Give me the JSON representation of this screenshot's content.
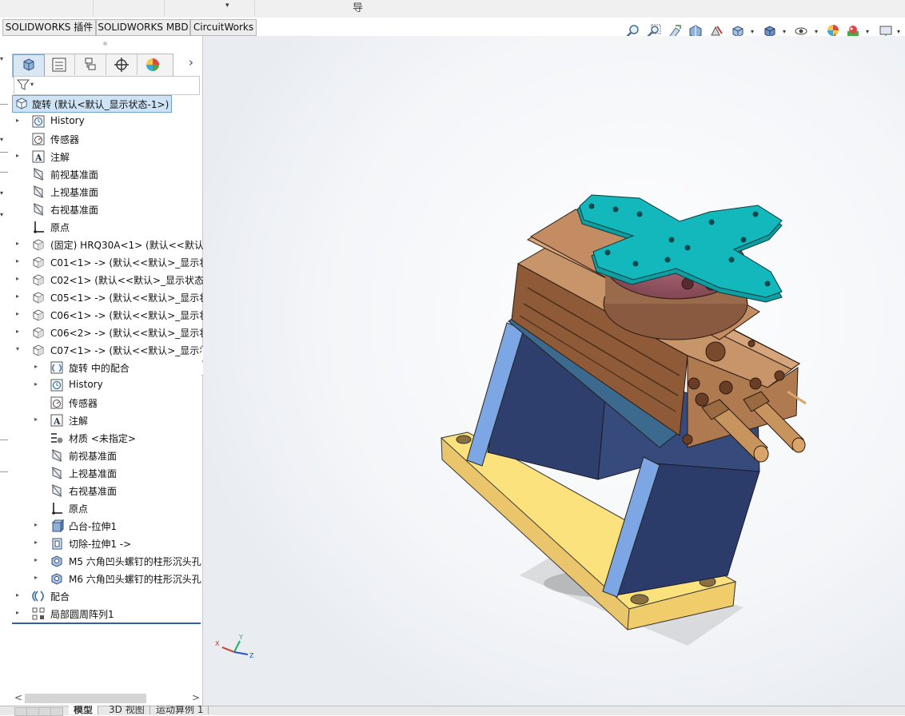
{
  "top_strip": {
    "dropdown_arrow": "▾",
    "glyph": "导"
  },
  "command_tabs": [
    "SOLIDWORKS 插件",
    "SOLIDWORKS MBD",
    "CircuitWorks"
  ],
  "view_toolbar": {
    "icons": [
      "zoom-to-fit-icon",
      "zoom-to-area-icon",
      "previous-view-icon",
      "section-view-icon",
      "dynamic-annotation-view-icon",
      "view-orientation-icon",
      "display-style-icon",
      "hide-show-items-icon",
      "edit-appearance-icon",
      "apply-scene-icon",
      "view-settings-icon"
    ]
  },
  "panel": {
    "tab_icons": [
      "featuremanager-tree-icon",
      "propertymanager-icon",
      "configurationmanager-icon",
      "dimxpertmanager-icon",
      "displaymanager-icon"
    ],
    "more_arrow": "›",
    "filter_dropdown": "▾"
  },
  "tree": {
    "root": {
      "label": "旋转  (默认<默认_显示状态-1>)",
      "icon": "assembly-icon"
    },
    "items": [
      {
        "label": "History",
        "icon": "history-icon",
        "level": 1,
        "toggle": "▸"
      },
      {
        "label": "传感器",
        "icon": "sensor-icon",
        "level": 1,
        "toggle": ""
      },
      {
        "label": "注解",
        "icon": "annotation-icon",
        "level": 1,
        "toggle": "▸"
      },
      {
        "label": "前视基准面",
        "icon": "plane-icon",
        "level": 1,
        "toggle": ""
      },
      {
        "label": "上视基准面",
        "icon": "plane-icon",
        "level": 1,
        "toggle": ""
      },
      {
        "label": "右视基准面",
        "icon": "plane-icon",
        "level": 1,
        "toggle": ""
      },
      {
        "label": "原点",
        "icon": "origin-icon",
        "level": 1,
        "toggle": ""
      },
      {
        "label": "(固定) HRQ30A<1> (默认<<默认>",
        "icon": "subassembly-icon",
        "level": 1,
        "toggle": "▸"
      },
      {
        "label": "C01<1> -> (默认<<默认>_显示状",
        "icon": "part-icon",
        "level": 1,
        "toggle": "▸"
      },
      {
        "label": "C02<1> (默认<<默认>_显示状态",
        "icon": "part-icon",
        "level": 1,
        "toggle": "▸"
      },
      {
        "label": "C05<1> -> (默认<<默认>_显示状",
        "icon": "part-icon",
        "level": 1,
        "toggle": "▸"
      },
      {
        "label": "C06<1> -> (默认<<默认>_显示状",
        "icon": "part-icon",
        "level": 1,
        "toggle": "▸"
      },
      {
        "label": "C06<2> -> (默认<<默认>_显示状",
        "icon": "part-icon",
        "level": 1,
        "toggle": "▸"
      },
      {
        "label": "C07<1> -> (默认<<默认>_显示状",
        "icon": "part-icon",
        "level": 1,
        "toggle": "▾"
      },
      {
        "label": "旋转 中的配合",
        "icon": "mates-in-assembly-icon",
        "level": 2,
        "toggle": "▸"
      },
      {
        "label": "History",
        "icon": "history-icon",
        "level": 2,
        "toggle": "▸"
      },
      {
        "label": "传感器",
        "icon": "sensor-icon",
        "level": 2,
        "toggle": ""
      },
      {
        "label": "注解",
        "icon": "annotation-icon",
        "level": 2,
        "toggle": "▸"
      },
      {
        "label": "材质 <未指定>",
        "icon": "material-icon",
        "level": 2,
        "toggle": ""
      },
      {
        "label": "前视基准面",
        "icon": "plane-icon",
        "level": 2,
        "toggle": ""
      },
      {
        "label": "上视基准面",
        "icon": "plane-icon",
        "level": 2,
        "toggle": ""
      },
      {
        "label": "右视基准面",
        "icon": "plane-icon",
        "level": 2,
        "toggle": ""
      },
      {
        "label": "原点",
        "icon": "origin-icon",
        "level": 2,
        "toggle": ""
      },
      {
        "label": "凸台-拉伸1",
        "icon": "boss-extrude-icon",
        "level": 2,
        "toggle": "▸"
      },
      {
        "label": "切除-拉伸1 ->",
        "icon": "cut-extrude-icon",
        "level": 2,
        "toggle": "▸"
      },
      {
        "label": "M5 六角凹头螺钉的柱形沉头孔",
        "icon": "hole-wizard-icon",
        "level": 2,
        "toggle": "▸"
      },
      {
        "label": "M6 六角凹头螺钉的柱形沉头孔",
        "icon": "hole-wizard-icon",
        "level": 2,
        "toggle": "▸"
      },
      {
        "label": "配合",
        "icon": "mates-icon",
        "level": 1,
        "toggle": "▸"
      },
      {
        "label": "局部圆周阵列1",
        "icon": "circular-pattern-icon",
        "level": 1,
        "toggle": "▸"
      }
    ]
  },
  "scrollbar": {
    "left": "<",
    "right": ">"
  },
  "bottom_tabs": [
    "模型",
    "3D 视图",
    "运动算例 1"
  ],
  "triad": {
    "x": "X",
    "y": "Y",
    "z": "Z"
  },
  "colors": {
    "selection": "#cfe3f6",
    "cyan_plate": "#11b5b8",
    "copper_body": "#b07a50",
    "navy_bracket": "#2d3e6e",
    "light_blue_plate": "#7ea8e6",
    "yellow_base": "#f5dc7d"
  }
}
